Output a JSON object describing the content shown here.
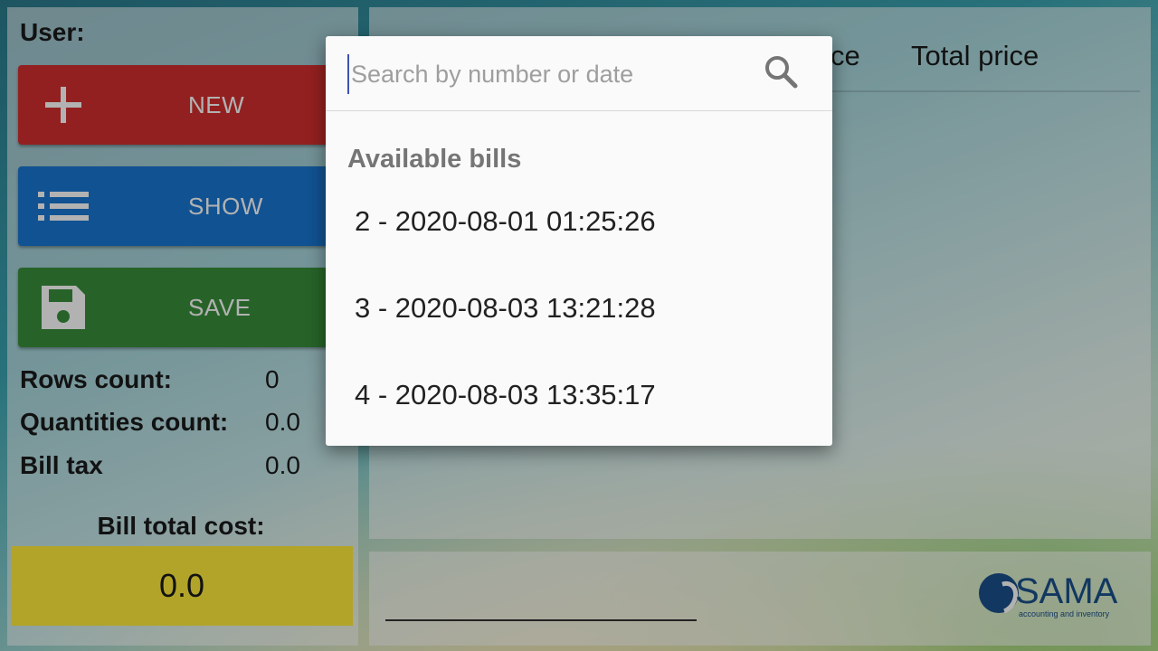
{
  "sidebar": {
    "user_label": "User:",
    "buttons": {
      "new": "NEW",
      "show": "SHOW",
      "save": "SAVE"
    },
    "stats": [
      {
        "label": "Rows count:",
        "value": "0"
      },
      {
        "label": "Quantities count:",
        "value": "0.0"
      },
      {
        "label": "Bill tax",
        "value": "0.0"
      }
    ],
    "total_label": "Bill total cost:",
    "total_value": "0.0"
  },
  "table": {
    "headers": {
      "price_partial": "ce",
      "total_price": "Total price"
    }
  },
  "logo": {
    "name": "SAMA",
    "tagline": "accounting and inventory"
  },
  "dialog": {
    "search_placeholder": "Search by number or date",
    "search_value": "",
    "list_title": "Available bills",
    "bills": [
      "2 - 2020-08-01 01:25:26",
      "3 - 2020-08-03 13:21:28",
      "4 - 2020-08-03 13:35:17"
    ]
  },
  "colors": {
    "new_button": "#d32f2f",
    "show_button": "#1976d2",
    "save_button": "#388e3c",
    "total_box": "#ffeb3b",
    "cursor": "#3f51b5"
  },
  "icons": {
    "new": "plus-icon",
    "show": "list-icon",
    "save": "floppy-disk-icon",
    "search": "search-icon"
  }
}
